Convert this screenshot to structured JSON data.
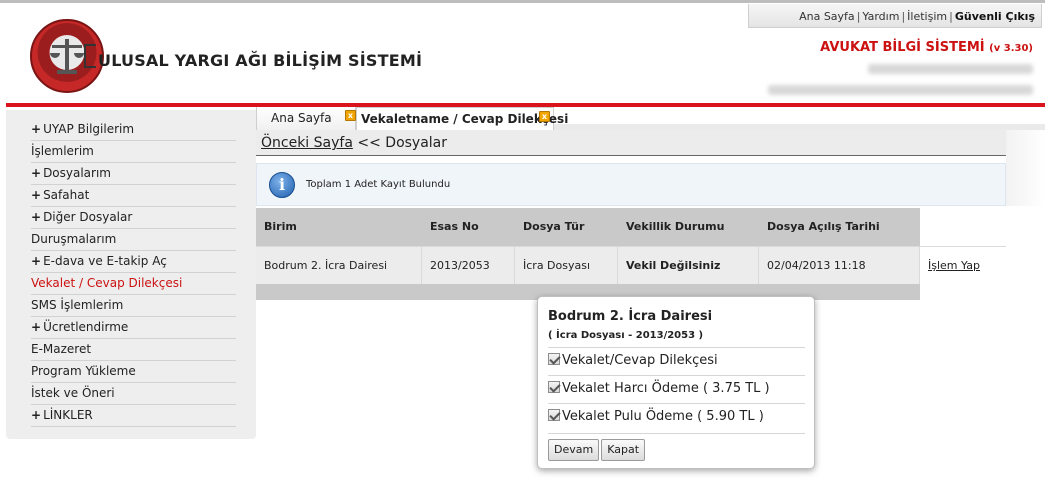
{
  "header": {
    "top_links": {
      "home": "Ana Sayfa",
      "help": "Yardım",
      "contact": "İletişim",
      "logout": "Güvenli Çıkış"
    },
    "system_name": "ULUSAL YARGI AĞI BİLİŞİM SİSTEMİ",
    "app_title": "AVUKAT BİLGİ SİSTEMİ",
    "app_version": "(v 3.30)"
  },
  "sidebar": {
    "items": [
      {
        "label": "UYAP Bilgilerim",
        "expandable": true
      },
      {
        "label": "İşlemlerim",
        "expandable": false
      },
      {
        "label": "Dosyalarım",
        "expandable": true
      },
      {
        "label": "Safahat",
        "expandable": true
      },
      {
        "label": "Diğer Dosyalar",
        "expandable": true
      },
      {
        "label": "Duruşmalarım",
        "expandable": false
      },
      {
        "label": "E-dava ve E-takip Aç",
        "expandable": true
      },
      {
        "label": "Vekalet / Cevap Dilekçesi",
        "expandable": false,
        "active": true
      },
      {
        "label": "SMS İşlemlerim",
        "expandable": false
      },
      {
        "label": "Ücretlendirme",
        "expandable": true
      },
      {
        "label": "E-Mazeret",
        "expandable": false
      },
      {
        "label": "Program Yükleme",
        "expandable": false
      },
      {
        "label": "İstek ve Öneri",
        "expandable": false
      },
      {
        "label": "LİNKLER",
        "expandable": true
      }
    ]
  },
  "tabs": [
    {
      "label": "Ana Sayfa"
    },
    {
      "label": "Vekaletname / Cevap Dilekçesi",
      "active": true
    }
  ],
  "breadcrumb": {
    "link": "Önceki Sayfa",
    "rest": "<< Dosyalar"
  },
  "info": {
    "message": "Toplam 1 Adet Kayıt Bulundu"
  },
  "table": {
    "columns": [
      "Birim",
      "Esas No",
      "Dosya Tür",
      "Vekillik Durumu",
      "Dosya Açılış Tarihi"
    ],
    "rows": [
      {
        "birim": "Bodrum 2. İcra Dairesi",
        "esas_no": "2013/2053",
        "dosya_tur": "İcra Dosyası",
        "vekillik": "Vekil Değilsiniz",
        "tarih": "02/04/2013 11:18",
        "action": "İşlem Yap"
      }
    ]
  },
  "popup": {
    "title": "Bodrum 2. İcra Dairesi",
    "subtitle": "( İcra Dosyası - 2013/2053 )",
    "options": [
      {
        "label": "Vekalet/Cevap Dilekçesi",
        "checked": true
      },
      {
        "label": "Vekalet Harcı Ödeme ( 3.75 TL )",
        "checked": true
      },
      {
        "label": "Vekalet Pulu Ödeme ( 5.90 TL )",
        "checked": true
      }
    ],
    "buttons": {
      "continue": "Devam",
      "close": "Kapat"
    }
  },
  "colors": {
    "accent_red": "#d9141c",
    "active_menu": "#cc1111",
    "table_header": "#c9c9c9"
  }
}
